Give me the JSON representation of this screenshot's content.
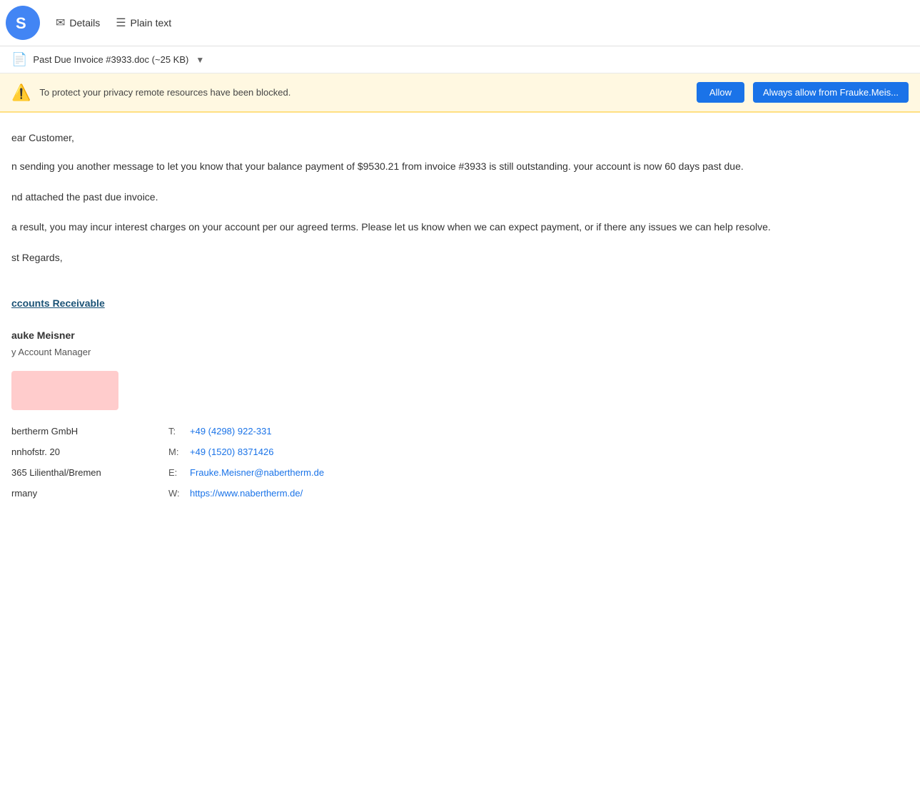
{
  "header": {
    "logo_char": "S",
    "details_label": "Details",
    "plain_text_label": "Plain text"
  },
  "attachment": {
    "filename": "Past Due Invoice #3933.doc",
    "size": "~25 KB"
  },
  "privacy_banner": {
    "warning_text": "To protect your privacy remote resources have been blocked.",
    "allow_label": "Allow",
    "always_allow_label": "Always allow from Frauke.Meis..."
  },
  "email": {
    "greeting": "ear Customer,",
    "paragraph1": "n sending you another message to let you know that your balance payment of $9530.21 from invoice #3933 is still outstanding. your account is now 60 days past due.",
    "paragraph2": "nd attached the past due invoice.",
    "paragraph3": "a result, you may incur interest charges on your account per our agreed terms. Please let us know when we can expect payment, or if there any issues we can help resolve.",
    "closing": "st Regards,",
    "department_link": "ccounts Receivable",
    "sender_name": "auke Meisner",
    "sender_title": "y Account Manager",
    "company": "bertherm GmbH",
    "street": "nnhofstr. 20",
    "city": "365 Lilienthal/Bremen",
    "country": "rmany",
    "contact_rows": [
      {
        "label": "",
        "type": "T:",
        "value": "+49 (4298) 922-331",
        "href": "tel:+494298922331"
      },
      {
        "label": "",
        "type": "M:",
        "value": "+49 (1520) 8371426",
        "href": "tel:+4915208371426"
      },
      {
        "label": "",
        "type": "E:",
        "value": "Frauke.Meisner@nabertherm.de",
        "href": "mailto:Frauke.Meisner@nabertherm.de"
      },
      {
        "label": "",
        "type": "W:",
        "value": "https://www.nabertherm.de/",
        "href": "https://www.nabertherm.de/"
      }
    ]
  }
}
